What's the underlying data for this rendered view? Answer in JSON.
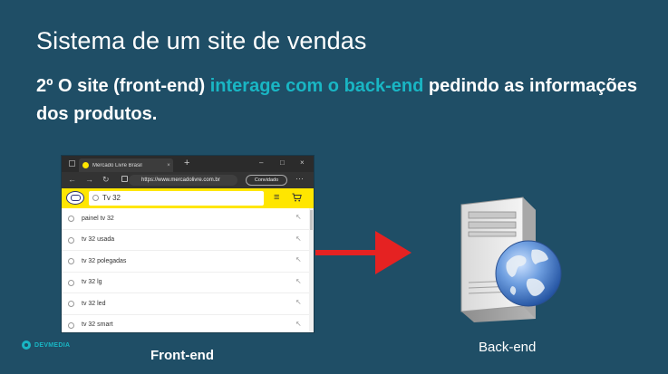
{
  "slide": {
    "title": "Sistema de um site de vendas",
    "subtitle_before": "2º O site (front-end) ",
    "subtitle_highlight": "interage com o back-end",
    "subtitle_after": " pedindo as informações dos produtos."
  },
  "browser": {
    "tab_title": "Mercado Livre Brasil",
    "tab_close": "×",
    "new_tab": "+",
    "window_controls": [
      "–",
      "□",
      "×"
    ],
    "nav_icons": [
      "←",
      "→",
      "↻"
    ],
    "url": "https://www.mercadolivre.com.br",
    "guest_label": "Convidado",
    "more": "···",
    "search_value": "Tv 32",
    "menu_icon": "≡",
    "suggestions": [
      "painel tv 32",
      "tv 32 usada",
      "tv 32 polegadas",
      "tv 32 lg",
      "tv 32 led",
      "tv 32 smart"
    ],
    "suggestion_arrow": "↖"
  },
  "labels": {
    "front_end": "Front-end",
    "back_end": "Back-end"
  },
  "brand": {
    "name": "DEVMEDIA"
  },
  "colors": {
    "background": "#1f4e66",
    "highlight": "#19b6c4",
    "arrow": "#e52222",
    "ml_yellow": "#ffe600"
  },
  "icons": [
    "search-icon",
    "red-arrow-icon",
    "server-icon",
    "globe-icon",
    "cart-icon",
    "menu-icon"
  ]
}
